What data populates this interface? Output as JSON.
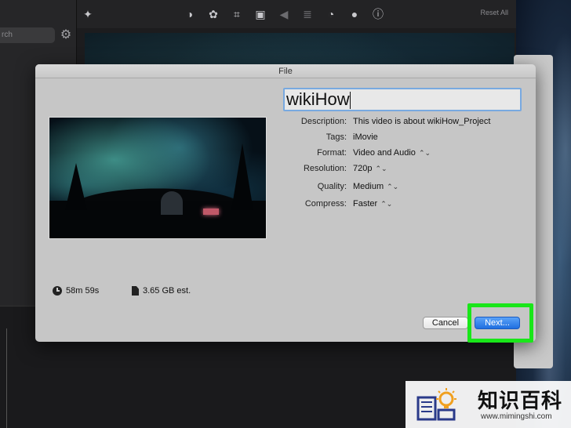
{
  "app": {
    "search_placeholder": "rch",
    "reset_all": "Reset All",
    "toolbar_icons": [
      "magic-wand-icon",
      "color-balance-icon",
      "palette-icon",
      "crop-icon",
      "camera-icon",
      "volume-icon",
      "equalizer-icon",
      "speed-icon",
      "filter-icon",
      "info-icon"
    ]
  },
  "dialog": {
    "title": "File",
    "name_value": "wikiHow",
    "fields": [
      {
        "label": "Description:",
        "value": "This video is about wikiHow_Project",
        "has_popup": false
      },
      {
        "label": "Tags:",
        "value": "iMovie",
        "has_popup": false
      },
      {
        "label": "Format:",
        "value": "Video and Audio",
        "has_popup": true
      },
      {
        "label": "Resolution:",
        "value": "720p",
        "has_popup": true
      },
      {
        "label": "Quality:",
        "value": "Medium",
        "has_popup": true
      },
      {
        "label": "Compress:",
        "value": "Faster",
        "has_popup": true
      }
    ],
    "duration": "58m 59s",
    "size_estimate": "3.65 GB est.",
    "cancel_label": "Cancel",
    "next_label": "Next..."
  },
  "colors": {
    "highlight": "#19e619",
    "primary_button": "#2f7fe8",
    "focus_ring": "#78a9e0"
  },
  "watermark": {
    "title": "知识百科",
    "url": "www.mimingshi.com"
  }
}
